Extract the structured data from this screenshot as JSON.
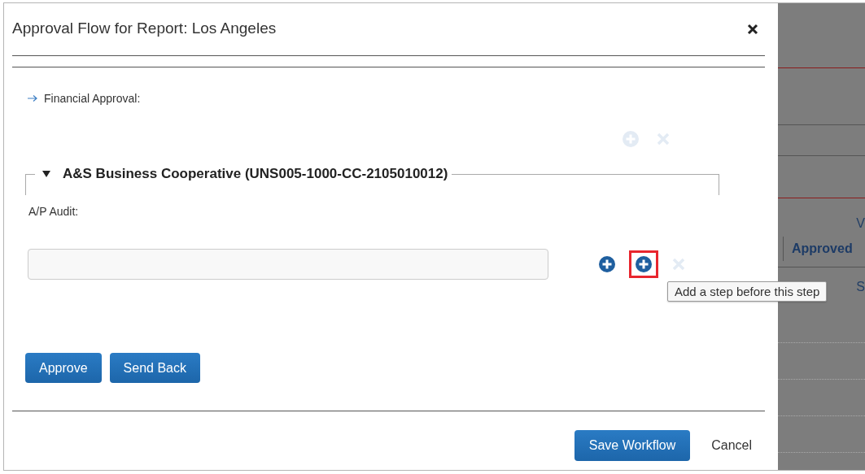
{
  "dialog": {
    "title": "Approval Flow for Report: Los Angeles",
    "step": {
      "label": "Financial Approval:",
      "actions": [
        {
          "kind": "add",
          "disabled": true,
          "highlighted": false
        },
        {
          "kind": "remove",
          "disabled": true,
          "highlighted": false
        }
      ]
    },
    "group": {
      "title": "A&S Business Cooperative (UNS005-1000-CC-2105010012)",
      "expanded": true
    },
    "field": {
      "label": "A/P Audit:",
      "actions": [
        {
          "kind": "add",
          "disabled": false,
          "highlighted": false
        },
        {
          "kind": "add",
          "disabled": false,
          "highlighted": true
        },
        {
          "kind": "remove",
          "disabled": true,
          "highlighted": false
        }
      ]
    },
    "tooltip": "Add a step before this step",
    "buttons": [
      "Approve",
      "Send Back"
    ],
    "footer_buttons": [
      {
        "label": "Save Workflow",
        "kind": "primary"
      },
      {
        "label": "Cancel",
        "kind": "plain"
      }
    ]
  },
  "background": {
    "texts": [
      "V",
      "Approved",
      "S"
    ]
  }
}
